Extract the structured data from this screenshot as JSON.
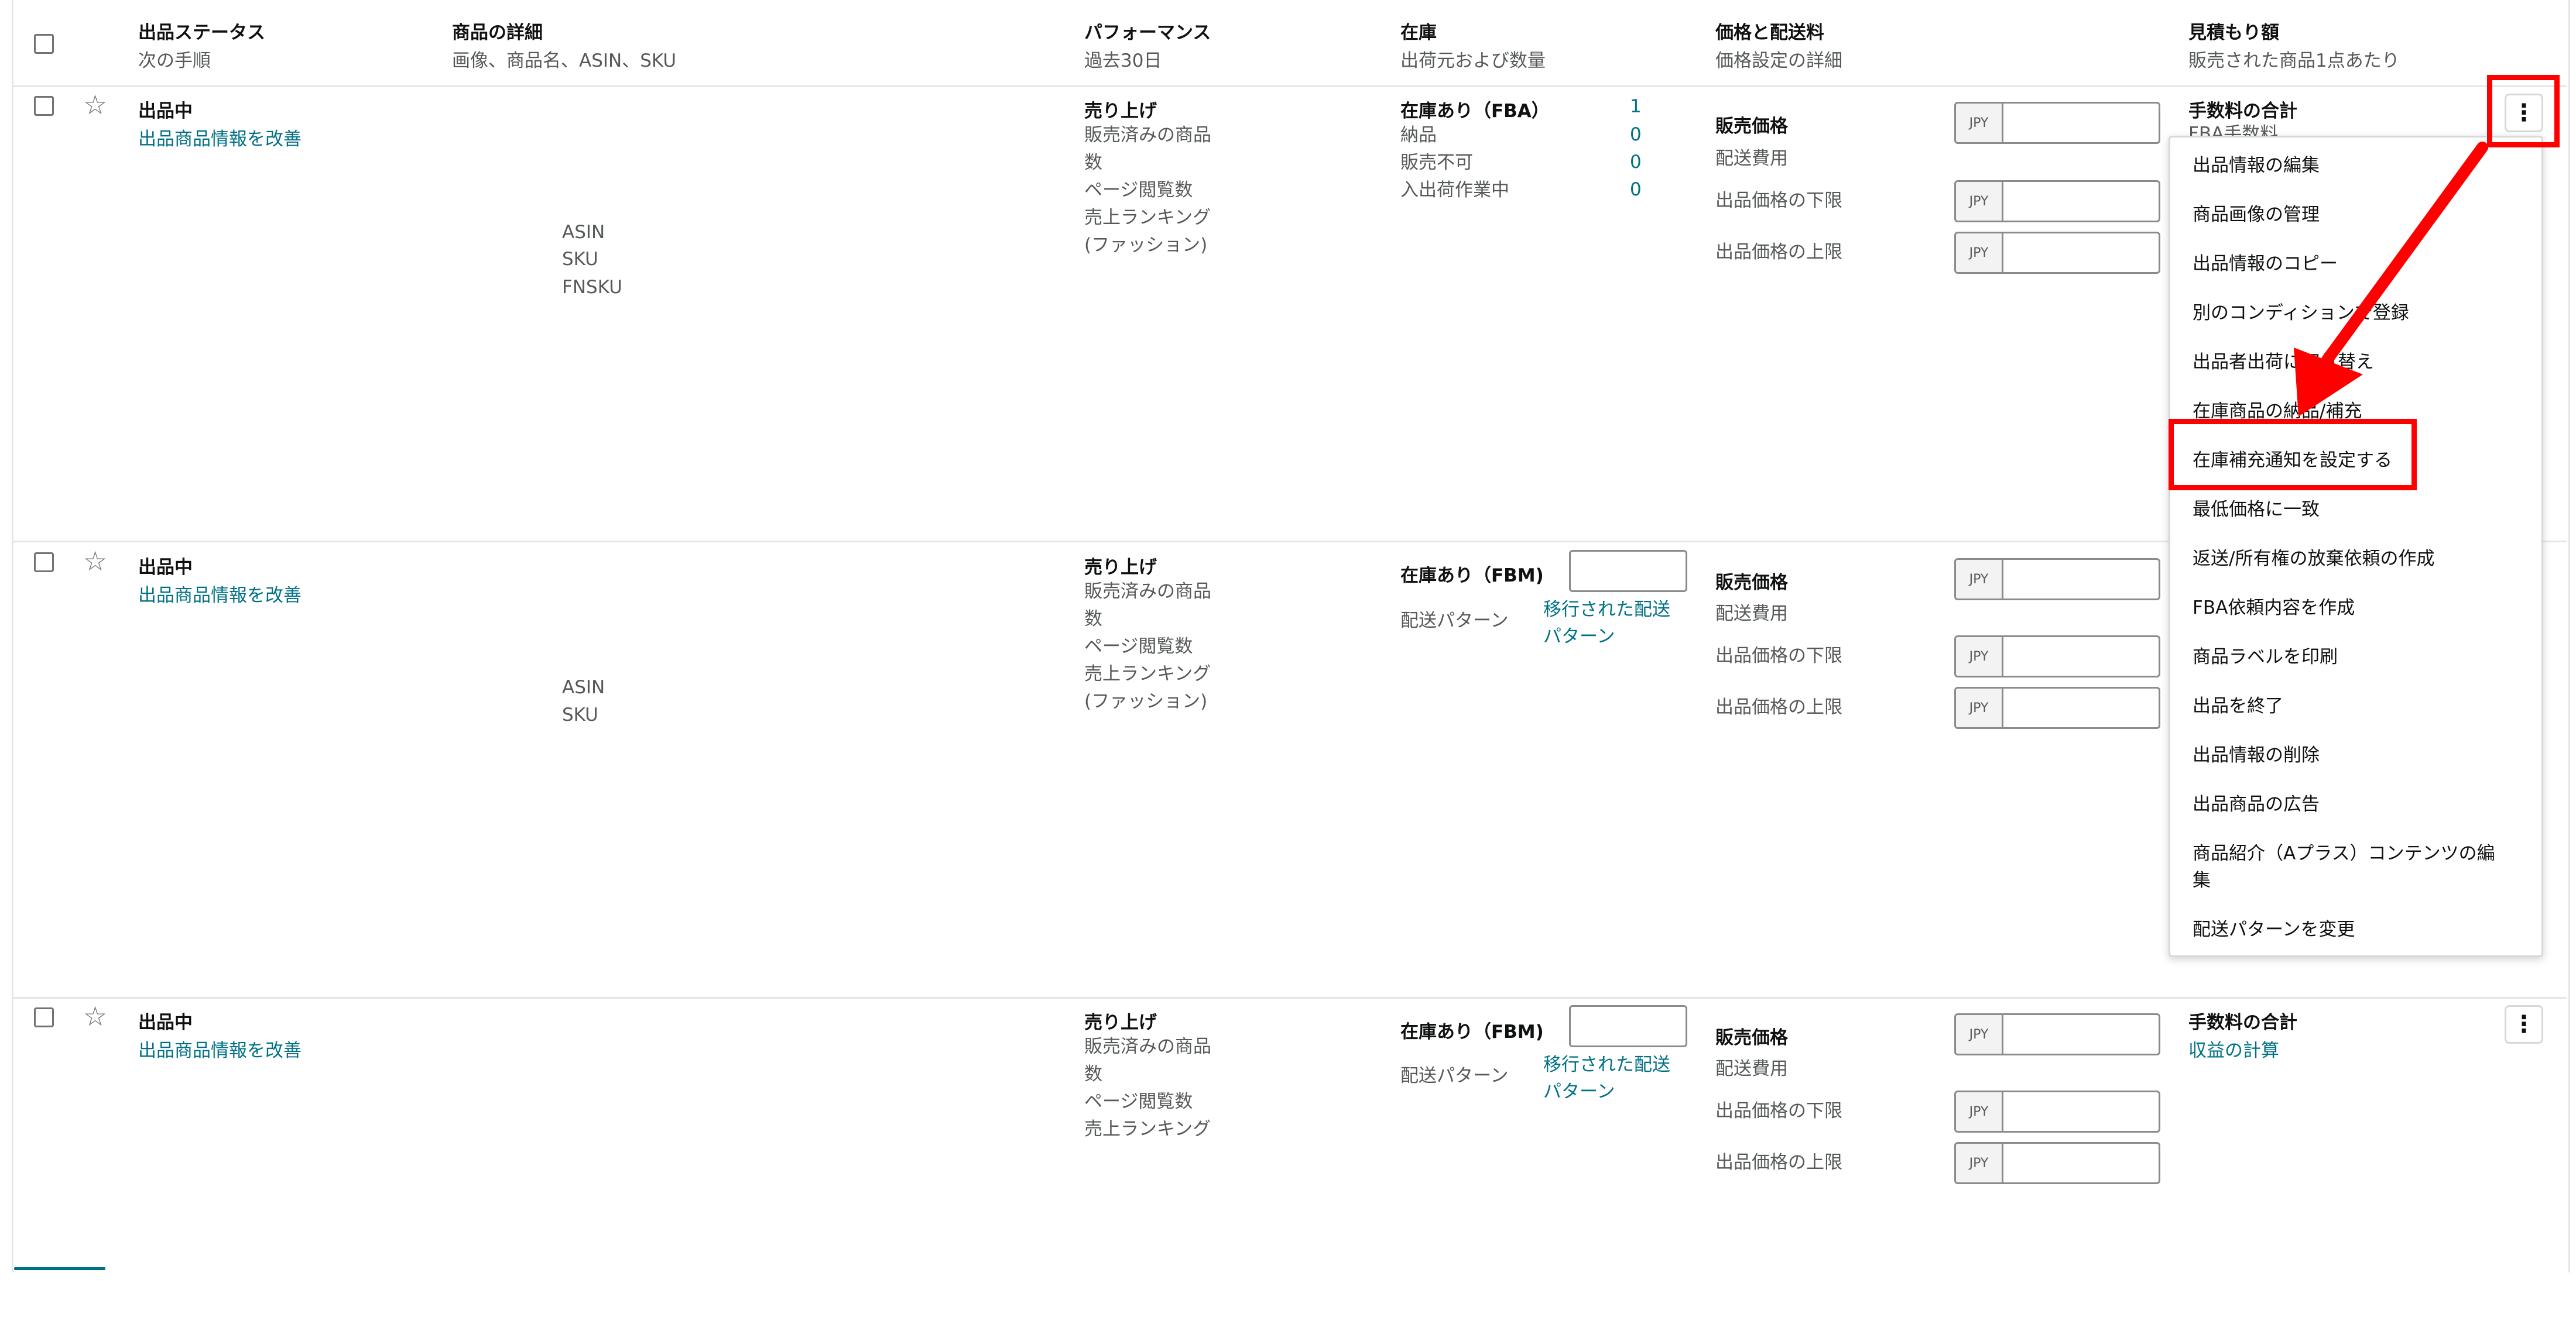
{
  "header": {
    "status_title": "出品ステータス",
    "status_sub": "次の手順",
    "details_title": "商品の詳細",
    "details_sub": "画像、商品名、ASIN、SKU",
    "perf_title": "パフォーマンス",
    "perf_sub": "過去30日",
    "inv_title": "在庫",
    "inv_sub": "出荷元および数量",
    "price_title": "価格と配送料",
    "price_sub": "価格設定の詳細",
    "est_title": "見積もり額",
    "est_sub": "販売された商品1点あたり"
  },
  "rows": [
    {
      "status": "出品中",
      "improve_link": "出品商品情報を改善",
      "ids": [
        "ASIN",
        "SKU",
        "FNSKU"
      ],
      "perf": [
        "売り上げ",
        "販売済みの商品",
        "数",
        "ページ閲覧数",
        "売上ランキング",
        "(ファッション)"
      ],
      "inventory_title": "在庫あり（FBA）",
      "inventory_labels": [
        "納品",
        "販売不可",
        "入出荷作業中"
      ],
      "inventory_values": [
        "1",
        "0",
        "0",
        "0"
      ],
      "price_labels": [
        "販売価格",
        "配送費用",
        "出品価格の下限",
        "出品価格の上限"
      ],
      "currency": "JPY",
      "fee_title": "手数料の合計",
      "fee_sub": "FBA手数料"
    },
    {
      "status": "出品中",
      "improve_link": "出品商品情報を改善",
      "ids": [
        "ASIN",
        "SKU"
      ],
      "perf": [
        "売り上げ",
        "販売済みの商品",
        "数",
        "ページ閲覧数",
        "売上ランキング",
        "(ファッション)"
      ],
      "inventory_title": "在庫あり（FBM)",
      "shipping_label": "配送パターン",
      "shipping_link_1": "移行された配送",
      "shipping_link_2": "パターン",
      "price_labels": [
        "販売価格",
        "配送費用",
        "出品価格の下限",
        "出品価格の上限"
      ],
      "currency": "JPY"
    },
    {
      "status": "出品中",
      "improve_link": "出品商品情報を改善",
      "perf": [
        "売り上げ",
        "販売済みの商品",
        "数",
        "ページ閲覧数",
        "売上ランキング"
      ],
      "inventory_title": "在庫あり（FBM)",
      "shipping_label": "配送パターン",
      "shipping_link_1": "移行された配送",
      "shipping_link_2": "パターン",
      "price_labels": [
        "販売価格",
        "配送費用",
        "出品価格の下限",
        "出品価格の上限"
      ],
      "currency": "JPY",
      "fee_title": "手数料の合計",
      "fee_link": "収益の計算"
    }
  ],
  "menu": {
    "items": [
      "出品情報の編集",
      "商品画像の管理",
      "出品情報のコピー",
      "別のコンディションで登録",
      "出品者出荷に切り替え",
      "在庫商品の納品/補充",
      "在庫補充通知を設定する",
      "最低価格に一致",
      "返送/所有権の放棄依頼の作成",
      "FBA依頼内容を作成",
      "商品ラベルを印刷",
      "出品を終了",
      "出品情報の削除",
      "出品商品の広告",
      "商品紹介（Aプラス）コンテンツの編",
      "集",
      "配送パターンを変更"
    ],
    "highlighted_index": 6
  },
  "annotation": {
    "color": "#ff0000"
  },
  "icons": {
    "star": "star-outline-icon",
    "kebab": "kebab-menu-icon"
  }
}
